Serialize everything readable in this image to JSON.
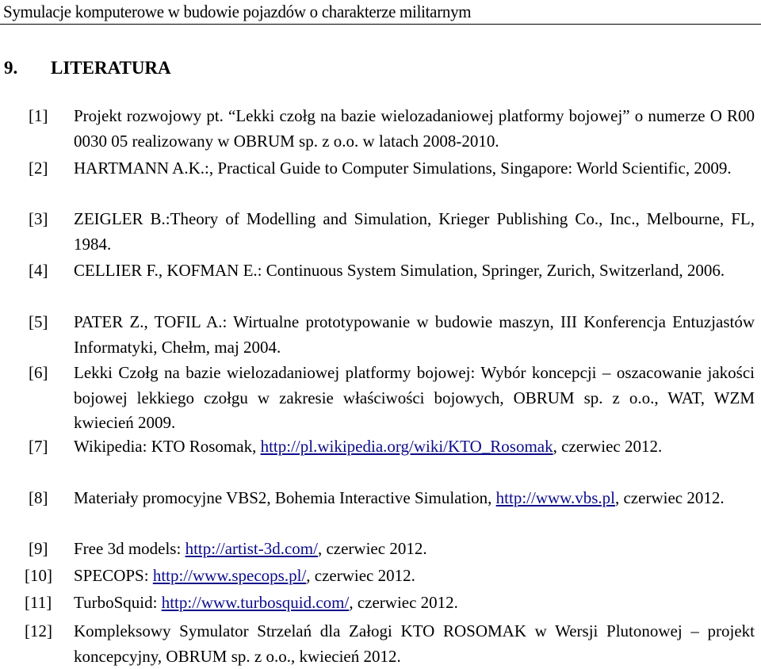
{
  "header": {
    "running_title": "Symulacje komputerowe w budowie pojazdów o charakterze militarnym"
  },
  "section": {
    "number": "9.",
    "title": "LITERATURA"
  },
  "link_color": "#0b0b8a",
  "references": [
    {
      "label": "[1]",
      "pre": "Projekt rozwojowy pt. “Lekki czołg na bazie wielozadaniowej platformy bojowej” o numerze O R00 0030 05 realizowany w OBRUM sp. z o.o. w latach 2008-2010.",
      "link": "",
      "post": ""
    },
    {
      "label": "[2]",
      "pre": "HARTMANN A.K.:, Practical Guide to Computer Simulations, Singapore: World Scientific, 2009.",
      "link": "",
      "post": ""
    },
    {
      "label": "[3]",
      "pre": "ZEIGLER B.:Theory of Modelling and Simulation, Krieger Publishing Co., Inc., Melbourne, FL, 1984.",
      "link": "",
      "post": ""
    },
    {
      "label": "[4]",
      "pre": "CELLIER F., KOFMAN E.: Continuous System Simulation, Springer, Zurich, Switzerland, 2006.",
      "link": "",
      "post": ""
    },
    {
      "label": "[5]",
      "pre": "PATER Z., TOFIL A.: Wirtualne prototypowanie w budowie maszyn, III Konferencja Entuzjastów Informatyki, Chełm, maj 2004.",
      "link": "",
      "post": ""
    },
    {
      "label": "[6]",
      "pre": "Lekki Czołg na bazie wielozadaniowej platformy bojowej: Wybór koncepcji – oszacowanie jakości bojowej lekkiego czołgu w zakresie właściwości bojowych, OBRUM sp. z o.o., WAT, WZM kwiecień 2009.",
      "link": "",
      "post": ""
    },
    {
      "label": "[7]",
      "pre": "Wikipedia: KTO Rosomak, ",
      "link": "http://pl.wikipedia.org/wiki/KTO_Rosomak",
      "post": ", czerwiec 2012."
    },
    {
      "label": "[8]",
      "pre": "Materiały promocyjne VBS2, Bohemia Interactive Simulation, ",
      "link": "http://www.vbs.pl",
      "post": ", czerwiec 2012."
    },
    {
      "label": "[9]",
      "pre": "Free 3d models: ",
      "link": "http://artist-3d.com/",
      "post": ", czerwiec 2012."
    },
    {
      "label": "[10]",
      "pre": "SPECOPS: ",
      "link": "http://www.specops.pl/",
      "post": ", czerwiec 2012."
    },
    {
      "label": "[11]",
      "pre": "TurboSquid: ",
      "link": "http://www.turbosquid.com/",
      "post": ",  czerwiec 2012."
    },
    {
      "label": "[12]",
      "pre": "Kompleksowy Symulator Strzelań dla Załogi KTO ROSOMAK w Wersji Plutonowej – projekt koncepcyjny, OBRUM sp. z o.o., kwiecień 2012.",
      "link": "",
      "post": ""
    }
  ]
}
